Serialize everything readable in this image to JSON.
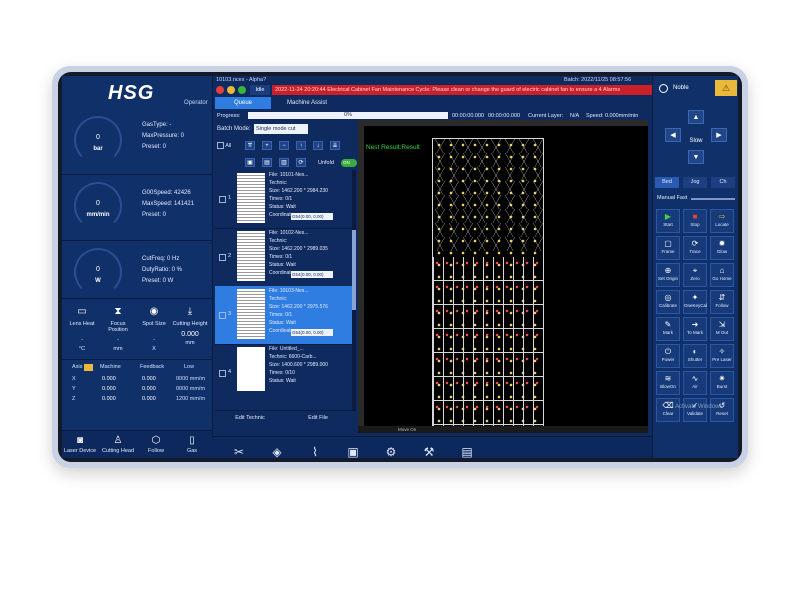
{
  "app": {
    "logo": "HSG",
    "role": "Operator",
    "file_title": "10103.ncex - Alpha?",
    "batch_info": "Batch: 2022/11/25 08:57:56"
  },
  "status": {
    "state": "Idle",
    "alarm_text": "2022-11-24 20:20:44 Electrical Cabinet Fan Maintenance Cycle: Please clean or change the guard of electric cabinet fan to ensure a  4 Alarms"
  },
  "tabs": [
    {
      "label": "Queue",
      "active": true
    },
    {
      "label": "Machine Assist",
      "active": false
    }
  ],
  "progress": {
    "label": "Progress:",
    "value_text": "0%",
    "fraction": 0.0,
    "time_a": "00:00:00.000",
    "time_b": "00:00:00.000",
    "current_layer_label": "Current Layer:",
    "current_layer_value": "N/A",
    "speed_label": "Speed: 0.000mm/min"
  },
  "batch_mode": {
    "label": "Batch Mode:",
    "value": "Single mode cut"
  },
  "list_controls": {
    "all_label": "All",
    "unfold_label": "Unfold",
    "toggle_label": "ON"
  },
  "jobs": [
    {
      "num": "1",
      "file": "File: 10101-Nes...",
      "technic": "Technic:",
      "size": "Size: 1462.200 * 2984.230",
      "times": "Times: 0/1",
      "status": "Status: Wait",
      "coordinate_label": "Coordinate",
      "coordinate": "G54(0.00, 0.00)"
    },
    {
      "num": "2",
      "file": "File: 10102-Nes...",
      "technic": "Technic:",
      "size": "Size: 1462.200 * 2989.035",
      "times": "Times: 0/1",
      "status": "Status: Wait",
      "coordinate_label": "Coordinate",
      "coordinate": "G54(0.00, 0.00)"
    },
    {
      "num": "3",
      "file": "File: 10103-Nes...",
      "technic": "Technic:",
      "size": "Size: 1462.200 * 2975.576",
      "times": "Times: 0/1",
      "status": "Status: Wait",
      "coordinate_label": "Coordinate",
      "coordinate": "G54(0.00, 0.00)"
    },
    {
      "num": "4",
      "file": "File: Untitled_...",
      "technic": "Technic: 6600-Carb...",
      "size": "Size: 1400.600 * 2989.000",
      "times": "Times: 0/10",
      "status": "Status: Wait",
      "coordinate_label": "",
      "coordinate": ""
    }
  ],
  "buttons": {
    "edit_technic": "Edit Technic",
    "edit_file": "Edit File"
  },
  "canvas": {
    "nest_label": "Nest Result:Result",
    "bottom_info": "Move On"
  },
  "gauges": [
    {
      "value": "0",
      "unit": "bar",
      "info": [
        "GasType: -",
        "MaxPressure: 0",
        "Preset: 0"
      ]
    },
    {
      "value": "0",
      "unit": "mm/min",
      "info": [
        "G00Speed: 42426",
        "MaxSpeed: 141421",
        "Preset: 0"
      ]
    },
    {
      "value": "0",
      "unit": "W",
      "info": [
        "CutFreq: 0 Hz",
        "DutyRatio: 0 %",
        "Preset: 0 W"
      ]
    }
  ],
  "tools": [
    {
      "label": "Lens Heat",
      "value": "-",
      "unit": "°C",
      "icon": "lens-heat-icon",
      "glyph": "▭"
    },
    {
      "label": "Focus Position",
      "value": "-",
      "unit": "mm",
      "icon": "focus-position-icon",
      "glyph": "⧗"
    },
    {
      "label": "Spot Size",
      "value": "-",
      "unit": "X",
      "icon": "spot-size-icon",
      "glyph": "◉"
    },
    {
      "label": "Cutting Height",
      "value": "0.000",
      "unit": "mm",
      "icon": "cutting-height-icon",
      "glyph": "⤓"
    }
  ],
  "axis_table": {
    "headers": [
      "Axis",
      "Machine",
      "Feedback",
      "Low"
    ],
    "rows": [
      {
        "axis": "X",
        "machine": "0.000",
        "feedback": "0.000",
        "low": "0000 mm/m"
      },
      {
        "axis": "Y",
        "machine": "0.000",
        "feedback": "0.000",
        "low": "0000 mm/m"
      },
      {
        "axis": "Z",
        "machine": "0.000",
        "feedback": "0.000",
        "low": "1200 mm/m"
      }
    ]
  },
  "left_bottom": [
    {
      "label": "Laser Device",
      "icon": "camera-icon",
      "glyph": "◙"
    },
    {
      "label": "Cutting Head",
      "icon": "cutting-head-icon",
      "glyph": "♙"
    },
    {
      "label": "Follow",
      "icon": "follow-icon",
      "glyph": "⬡"
    },
    {
      "label": "Gas",
      "icon": "gas-icon",
      "glyph": "▯"
    }
  ],
  "bottom_bar_icons": [
    {
      "icon": "tools-icon",
      "glyph": "✂"
    },
    {
      "icon": "layers-icon",
      "glyph": "◈"
    },
    {
      "icon": "chart-icon",
      "glyph": "⌇"
    },
    {
      "icon": "save-icon",
      "glyph": "▣"
    },
    {
      "icon": "settings-icon",
      "glyph": "⚙"
    },
    {
      "icon": "wrench-icon",
      "glyph": "⚒"
    },
    {
      "icon": "document-icon",
      "glyph": "▤"
    }
  ],
  "right_panel": {
    "user_label": "Noble",
    "warn_glyph": "⚠",
    "slow_label": "Slow",
    "tabs": [
      "Bed",
      "Jog",
      "Ch"
    ],
    "mode_label": "Manual Fast",
    "buttons": [
      {
        "label": "Start",
        "icon": "start-icon",
        "glyph": "▶"
      },
      {
        "label": "Stop",
        "icon": "stop-icon",
        "glyph": "■"
      },
      {
        "label": "Locate",
        "icon": "locate-icon",
        "glyph": "⇨"
      },
      {
        "label": "Frame",
        "icon": "frame-icon",
        "glyph": "▢"
      },
      {
        "label": "Trace",
        "icon": "trace-icon",
        "glyph": "⟳"
      },
      {
        "label": "Glow",
        "icon": "glow-icon",
        "glyph": "✹"
      },
      {
        "label": "Set Origin",
        "icon": "set-origin-icon",
        "glyph": "⊕"
      },
      {
        "label": "Zero",
        "icon": "zero-icon",
        "glyph": "⌖"
      },
      {
        "label": "Go Home",
        "icon": "home-icon",
        "glyph": "⌂"
      },
      {
        "label": "Calibrate",
        "icon": "calibrate-icon",
        "glyph": "◎"
      },
      {
        "label": "OneKeyCal",
        "icon": "onekeycal-icon",
        "glyph": "✦"
      },
      {
        "label": "Follow",
        "icon": "follow-btn-icon",
        "glyph": "⇵"
      },
      {
        "label": "Mark",
        "icon": "mark-icon",
        "glyph": "✎"
      },
      {
        "label": "To Mark",
        "icon": "to-mark-icon",
        "glyph": "➜"
      },
      {
        "label": "M Out",
        "icon": "m-out-icon",
        "glyph": "⇲"
      },
      {
        "label": "Power",
        "icon": "power-icon",
        "glyph": "⏻"
      },
      {
        "label": "Shutter",
        "icon": "shutter-icon",
        "glyph": "◐"
      },
      {
        "label": "Pre Laser",
        "icon": "pre-laser-icon",
        "glyph": "✧"
      },
      {
        "label": "BlowOn",
        "icon": "blow-icon",
        "glyph": "≋"
      },
      {
        "label": "Air",
        "icon": "air-icon",
        "glyph": "∿"
      },
      {
        "label": "Burst",
        "icon": "burst-icon",
        "glyph": "✷"
      },
      {
        "label": "Clear",
        "icon": "clear-icon",
        "glyph": "⌫"
      },
      {
        "label": "Validate",
        "icon": "validate-icon",
        "glyph": "✓"
      },
      {
        "label": "Reset",
        "icon": "reset-icon",
        "glyph": "↺"
      }
    ]
  },
  "watermark": "Activate Windows",
  "colors": {
    "alarm": "#c9202a",
    "selected": "#2f7de0",
    "nest_text": "#34d83f",
    "panel": "#10306a"
  }
}
